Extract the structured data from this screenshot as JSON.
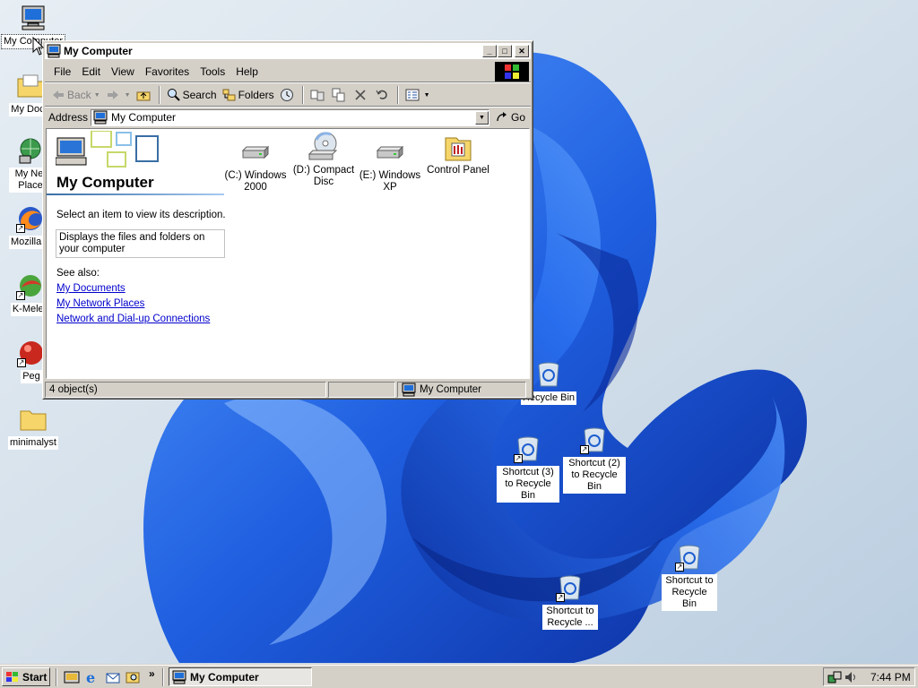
{
  "desktop": {
    "icons": [
      {
        "name": "desktop-icon-my-computer",
        "label": "My Computer"
      },
      {
        "name": "desktop-icon-my-documents",
        "label": "My Docu"
      },
      {
        "name": "desktop-icon-my-network",
        "label": "My Net Place"
      },
      {
        "name": "desktop-icon-mozilla",
        "label": "Mozilla F"
      },
      {
        "name": "desktop-icon-kmeleon",
        "label": "K-Melec"
      },
      {
        "name": "desktop-icon-peg",
        "label": "Peg"
      },
      {
        "name": "desktop-icon-minimalyst",
        "label": "minimalyst"
      },
      {
        "name": "desktop-icon-recycle-bin",
        "label": "Recycle Bin"
      },
      {
        "name": "desktop-icon-shortcut-3",
        "label": "Shortcut (3) to Recycle Bin"
      },
      {
        "name": "desktop-icon-shortcut-2",
        "label": "Shortcut (2) to Recycle Bin"
      },
      {
        "name": "desktop-icon-shortcut-1",
        "label": "Shortcut to Recycle Bin"
      },
      {
        "name": "desktop-icon-shortcut-truncated",
        "label": "Shortcut to Recycle ..."
      }
    ]
  },
  "window": {
    "title": "My Computer",
    "menu": [
      "File",
      "Edit",
      "View",
      "Favorites",
      "Tools",
      "Help"
    ],
    "toolbar": {
      "back": "Back",
      "search": "Search",
      "folders": "Folders"
    },
    "address": {
      "label": "Address",
      "value": "My Computer",
      "go": "Go"
    },
    "left_pane": {
      "title": "My Computer",
      "select_hint": "Select an item to view its description.",
      "description": "Displays the files and folders on your computer",
      "see_also": "See also:",
      "links": [
        "My Documents",
        "My Network Places",
        "Network and Dial-up Connections"
      ]
    },
    "items": [
      {
        "label": "(C:) Windows 2000",
        "icon": "hard-drive-icon"
      },
      {
        "label": "(D:) Compact Disc",
        "icon": "cd-drive-icon"
      },
      {
        "label": "(E:) Windows XP",
        "icon": "hard-drive-icon"
      },
      {
        "label": "Control Panel",
        "icon": "control-panel-icon"
      }
    ],
    "status": {
      "count": "4 object(s)",
      "zone": "My Computer"
    }
  },
  "taskbar": {
    "start": "Start",
    "task": "My Computer",
    "quicklaunch_more": "»",
    "time": "7:44 PM"
  },
  "colors": {
    "wallpaper_blue": "#1f63e0",
    "window_face": "#d4d0c8",
    "link": "#0000cc"
  }
}
